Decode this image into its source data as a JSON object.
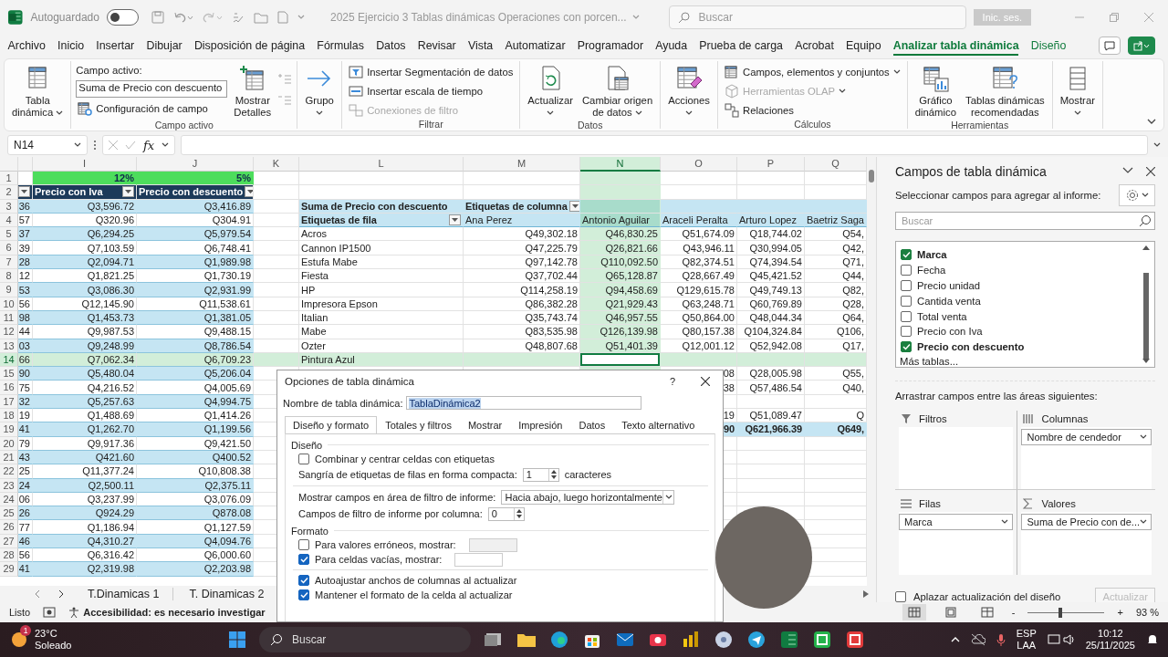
{
  "title_bar": {
    "autosave_label": "Autoguardado",
    "autosave_on": false,
    "document_title": "2025 Ejercicio 3 Tablas dinámicas Operaciones con porcen...",
    "search_placeholder": "Buscar",
    "sign_in_button": "Inic. ses."
  },
  "menu_tabs": [
    {
      "label": "Archivo",
      "selected": false,
      "contextual": false
    },
    {
      "label": "Inicio",
      "selected": false,
      "contextual": false
    },
    {
      "label": "Insertar",
      "selected": false,
      "contextual": false
    },
    {
      "label": "Dibujar",
      "selected": false,
      "contextual": false
    },
    {
      "label": "Disposición de página",
      "selected": false,
      "contextual": false
    },
    {
      "label": "Fórmulas",
      "selected": false,
      "contextual": false
    },
    {
      "label": "Datos",
      "selected": false,
      "contextual": false
    },
    {
      "label": "Revisar",
      "selected": false,
      "contextual": false
    },
    {
      "label": "Vista",
      "selected": false,
      "contextual": false
    },
    {
      "label": "Automatizar",
      "selected": false,
      "contextual": false
    },
    {
      "label": "Programador",
      "selected": false,
      "contextual": false
    },
    {
      "label": "Ayuda",
      "selected": false,
      "contextual": false
    },
    {
      "label": "Prueba de carga",
      "selected": false,
      "contextual": false
    },
    {
      "label": "Acrobat",
      "selected": false,
      "contextual": false
    },
    {
      "label": "Equipo",
      "selected": false,
      "contextual": false
    },
    {
      "label": "Analizar tabla dinámica",
      "selected": true,
      "contextual": true
    },
    {
      "label": "Diseño",
      "selected": false,
      "contextual": true
    }
  ],
  "ribbon_groups": [
    {
      "items": [
        {
          "kind": "large",
          "lines": [
            "Tabla",
            "dinámica"
          ],
          "caret": true,
          "disabled": false
        }
      ]
    },
    {
      "label": "Campo activo",
      "items": [
        {
          "kind": "stack",
          "items": [
            {
              "kind": "text",
              "label": "Campo activo:"
            },
            {
              "kind": "field",
              "value": "Suma de Precio con descuento"
            },
            {
              "kind": "small",
              "label": "Configuración de campo",
              "disabled": false
            }
          ]
        },
        {
          "kind": "large",
          "lines": [
            "Mostrar",
            "Detalles"
          ],
          "disabled": false
        },
        {
          "kind": "icons",
          "count_disabled": true
        }
      ]
    },
    {
      "items": [
        {
          "kind": "large",
          "lines": [
            "Grupo"
          ],
          "caret": true,
          "disabled": false
        }
      ]
    },
    {
      "label": "Filtrar",
      "items": [
        {
          "kind": "stack",
          "items": [
            {
              "kind": "small",
              "label": "Insertar Segmentación de datos",
              "disabled": false
            },
            {
              "kind": "small",
              "label": "Insertar escala de tiempo",
              "disabled": false
            },
            {
              "kind": "small",
              "label": "Conexiones de filtro",
              "disabled": true
            }
          ]
        }
      ]
    },
    {
      "label": "Datos",
      "items": [
        {
          "kind": "large",
          "lines": [
            "Actualizar"
          ],
          "caret": true,
          "disabled": false
        },
        {
          "kind": "large",
          "lines": [
            "Cambiar origen",
            "de datos"
          ],
          "caret": true,
          "disabled": false
        }
      ]
    },
    {
      "items": [
        {
          "kind": "large",
          "lines": [
            "Acciones"
          ],
          "caret": true,
          "disabled": false
        }
      ]
    },
    {
      "label": "Cálculos",
      "items": [
        {
          "kind": "stack",
          "items": [
            {
              "kind": "small",
              "label": "Campos, elementos y conjuntos",
              "caret": true,
              "disabled": false
            },
            {
              "kind": "small",
              "label": "Herramientas OLAP",
              "caret": true,
              "disabled": true
            },
            {
              "kind": "small",
              "label": "Relaciones",
              "disabled": false
            }
          ]
        }
      ]
    },
    {
      "label": "Herramientas",
      "items": [
        {
          "kind": "large",
          "lines": [
            "Gráfico",
            "dinámico"
          ],
          "disabled": false
        },
        {
          "kind": "large",
          "lines": [
            "Tablas dinámicas",
            "recomendadas"
          ],
          "disabled": false
        }
      ]
    },
    {
      "items": [
        {
          "kind": "large",
          "lines": [
            "Mostrar"
          ],
          "caret": true,
          "disabled": false
        }
      ]
    }
  ],
  "formula_bar": {
    "name_box": "N14",
    "function_label": "fx"
  },
  "sheet": {
    "column_headers": [
      {
        "label": "I",
        "selected": false
      },
      {
        "label": "J",
        "selected": false
      },
      {
        "label": "K",
        "selected": false
      },
      {
        "label": "L",
        "selected": false
      },
      {
        "label": "M",
        "selected": false
      },
      {
        "label": "N",
        "selected": true
      },
      {
        "label": "O",
        "selected": false
      },
      {
        "label": "P",
        "selected": false
      },
      {
        "label": "Q",
        "selected": false
      }
    ],
    "rows": [
      {
        "number": "1",
        "kind": "percent",
        "selected": false,
        "cells": [
          null,
          "12%",
          "5%",
          null,
          null,
          null,
          null,
          null,
          null,
          null
        ]
      },
      {
        "number": "2",
        "kind": "header",
        "selected": false,
        "cells": [
          {
            "filter": true
          },
          {
            "text": "Precio con Iva",
            "filter": true
          },
          {
            "text": "Precio con descuento",
            "filter": true
          },
          null,
          null,
          null,
          null,
          null,
          null,
          null
        ]
      },
      {
        "number": "3",
        "kind": "pivot-caption",
        "selected": false,
        "cells": [
          "36",
          "Q3,596.72",
          "Q3,416.89",
          null,
          "Suma de Precio con descuento",
          {
            "text": "Etiquetas de columna",
            "filter": true
          },
          null,
          null,
          null,
          null
        ]
      },
      {
        "number": "4",
        "kind": "pivot-header",
        "selected": false,
        "cells": [
          "57",
          "Q320.96",
          "Q304.91",
          null,
          {
            "text": "Etiquetas de fila",
            "filter": true
          },
          "Ana Perez",
          "Antonio Aguilar",
          "Araceli Peralta",
          "Arturo Lopez",
          "Baetriz Saga"
        ]
      },
      {
        "number": "5",
        "kind": "data",
        "selected": false,
        "cells": [
          "37",
          "Q6,294.25",
          "Q5,979.54",
          null,
          "Acros",
          "Q49,302.18",
          "Q46,830.25",
          "Q51,674.09",
          "Q18,744.02",
          "Q54,"
        ]
      },
      {
        "number": "6",
        "kind": "data",
        "selected": false,
        "cells": [
          "39",
          "Q7,103.59",
          "Q6,748.41",
          null,
          "Cannon IP1500",
          "Q47,225.79",
          "Q26,821.66",
          "Q43,946.11",
          "Q30,994.05",
          "Q42,"
        ]
      },
      {
        "number": "7",
        "kind": "data",
        "selected": false,
        "cells": [
          "28",
          "Q2,094.71",
          "Q1,989.98",
          null,
          "Estufa Mabe",
          "Q97,142.78",
          "Q110,092.50",
          "Q82,374.51",
          "Q74,394.54",
          "Q71,"
        ]
      },
      {
        "number": "8",
        "kind": "data",
        "selected": false,
        "cells": [
          "12",
          "Q1,821.25",
          "Q1,730.19",
          null,
          "Fiesta",
          "Q37,702.44",
          "Q65,128.87",
          "Q28,667.49",
          "Q45,421.52",
          "Q44,"
        ]
      },
      {
        "number": "9",
        "kind": "data",
        "selected": false,
        "cells": [
          "53",
          "Q3,086.30",
          "Q2,931.99",
          null,
          "HP",
          "Q114,258.19",
          "Q94,458.69",
          "Q129,615.78",
          "Q49,749.13",
          "Q82,"
        ]
      },
      {
        "number": "10",
        "kind": "data",
        "selected": false,
        "cells": [
          "56",
          "Q12,145.90",
          "Q11,538.61",
          null,
          "Impresora Epson",
          "Q86,382.28",
          "Q21,929.43",
          "Q63,248.71",
          "Q60,769.89",
          "Q28,"
        ]
      },
      {
        "number": "11",
        "kind": "data",
        "selected": false,
        "cells": [
          "98",
          "Q1,453.73",
          "Q1,381.05",
          null,
          "Italian",
          "Q35,743.74",
          "Q46,957.55",
          "Q50,864.00",
          "Q48,044.34",
          "Q64,"
        ]
      },
      {
        "number": "12",
        "kind": "data",
        "selected": false,
        "cells": [
          "44",
          "Q9,987.53",
          "Q9,488.15",
          null,
          "Mabe",
          "Q83,535.98",
          "Q126,139.98",
          "Q80,157.38",
          "Q104,324.84",
          "Q106,"
        ]
      },
      {
        "number": "13",
        "kind": "data",
        "selected": false,
        "cells": [
          "03",
          "Q9,248.99",
          "Q8,786.54",
          null,
          "Ozter",
          "Q48,807.68",
          "Q51,401.39",
          "Q12,001.12",
          "Q52,942.08",
          "Q17,"
        ]
      },
      {
        "number": "14",
        "kind": "data",
        "selected": true,
        "cells": [
          "66",
          "Q7,062.34",
          "Q6,709.23",
          null,
          "Pintura Azul",
          null,
          null,
          null,
          null,
          null
        ]
      },
      {
        "number": "15",
        "kind": "data",
        "selected": false,
        "cells": [
          "90",
          "Q5,480.04",
          "Q5,206.04",
          null,
          null,
          null,
          null,
          "08",
          "Q28,005.98",
          "Q55,"
        ]
      },
      {
        "number": "16",
        "kind": "data",
        "selected": false,
        "cells": [
          "75",
          "Q4,216.52",
          "Q4,005.69",
          null,
          null,
          null,
          null,
          "38",
          "Q57,486.54",
          "Q40,"
        ]
      },
      {
        "number": "17",
        "kind": "data",
        "selected": false,
        "cells": [
          "32",
          "Q5,257.63",
          "Q4,994.75",
          null,
          null,
          null,
          null,
          null,
          null,
          null
        ]
      },
      {
        "number": "18",
        "kind": "data",
        "selected": false,
        "cells": [
          "19",
          "Q1,488.69",
          "Q1,414.26",
          null,
          null,
          null,
          null,
          "19",
          "Q51,089.47",
          "Q"
        ]
      },
      {
        "number": "19",
        "kind": "pivot-total",
        "selected": false,
        "cells": [
          "41",
          "Q1,262.70",
          "Q1,199.56",
          null,
          null,
          null,
          null,
          "90",
          "Q621,966.39",
          "Q649,"
        ]
      },
      {
        "number": "20",
        "kind": "data",
        "selected": false,
        "cells": [
          "79",
          "Q9,917.36",
          "Q9,421.50",
          null,
          null,
          null,
          null,
          null,
          null,
          null
        ]
      },
      {
        "number": "21",
        "kind": "data",
        "selected": false,
        "cells": [
          "43",
          "Q421.60",
          "Q400.52",
          null,
          null,
          null,
          null,
          null,
          null,
          null
        ]
      },
      {
        "number": "22",
        "kind": "data",
        "selected": false,
        "cells": [
          "25",
          "Q11,377.24",
          "Q10,808.38",
          null,
          null,
          null,
          null,
          null,
          null,
          null
        ]
      },
      {
        "number": "23",
        "kind": "data",
        "selected": false,
        "cells": [
          "24",
          "Q2,500.11",
          "Q2,375.11",
          null,
          null,
          null,
          null,
          null,
          null,
          null
        ]
      },
      {
        "number": "24",
        "kind": "data",
        "selected": false,
        "cells": [
          "06",
          "Q3,237.99",
          "Q3,076.09",
          null,
          null,
          null,
          null,
          null,
          null,
          null
        ]
      },
      {
        "number": "25",
        "kind": "data",
        "selected": false,
        "cells": [
          "26",
          "Q924.29",
          "Q878.08",
          null,
          null,
          null,
          null,
          null,
          null,
          null
        ]
      },
      {
        "number": "26",
        "kind": "data",
        "selected": false,
        "cells": [
          "77",
          "Q1,186.94",
          "Q1,127.59",
          null,
          null,
          null,
          null,
          null,
          null,
          null
        ]
      },
      {
        "number": "27",
        "kind": "data",
        "selected": false,
        "cells": [
          "46",
          "Q4,310.27",
          "Q4,094.76",
          null,
          null,
          null,
          null,
          null,
          null,
          null
        ]
      },
      {
        "number": "28",
        "kind": "data",
        "selected": false,
        "cells": [
          "56",
          "Q6,316.42",
          "Q6,000.60",
          null,
          null,
          null,
          null,
          null,
          null,
          null
        ]
      },
      {
        "number": "29",
        "kind": "data",
        "selected": false,
        "cells": [
          "41",
          "Q2,319.98",
          "Q2,203.98",
          null,
          null,
          null,
          null,
          null,
          null,
          null
        ]
      }
    ]
  },
  "sheet_tabs": [
    {
      "label": "T.Dinamicas 1"
    },
    {
      "label": "T. Dinamicas 2"
    }
  ],
  "dialog": {
    "title": "Opciones de tabla dinámica",
    "help": "?",
    "name_label": "Nombre de tabla dinámica:",
    "name_value": "TablaDinámica2",
    "tabs": [
      {
        "label": "Diseño y formato",
        "selected": true
      },
      {
        "label": "Totales y filtros",
        "selected": false
      },
      {
        "label": "Mostrar",
        "selected": false
      },
      {
        "label": "Impresión",
        "selected": false
      },
      {
        "label": "Datos",
        "selected": false
      },
      {
        "label": "Texto alternativo",
        "selected": false
      }
    ],
    "sections": [
      {
        "heading": "Diseño",
        "rows": [
          {
            "kind": "checkbox",
            "label": "Combinar y centrar celdas con etiquetas",
            "checked": false
          },
          {
            "kind": "spinner",
            "label": "Sangría de etiquetas de filas en forma compacta:",
            "value": "1",
            "suffix": "caracteres"
          },
          {
            "kind": "separator"
          },
          {
            "kind": "dropdown",
            "label": "Mostrar campos en área de filtro de informe:",
            "value": "Hacia abajo, luego horizontalmente"
          },
          {
            "kind": "spinner",
            "label": "Campos de filtro de informe por columna:",
            "value": "0"
          }
        ]
      },
      {
        "heading": "Formato",
        "rows": [
          {
            "kind": "checkbox-field",
            "label": "Para valores erróneos, mostrar:",
            "checked": false,
            "field_disabled": true
          },
          {
            "kind": "checkbox-field",
            "label": "Para celdas vacías, mostrar:",
            "checked": true,
            "field_disabled": false
          },
          {
            "kind": "separator"
          },
          {
            "kind": "checkbox",
            "label": "Autoajustar anchos de columnas al actualizar",
            "checked": true
          },
          {
            "kind": "checkbox",
            "label": "Mantener el formato de la celda al actualizar",
            "checked": true
          }
        ]
      }
    ]
  },
  "field_pane": {
    "title": "Campos de tabla dinámica",
    "subtitle": "Seleccionar campos para agregar al informe:",
    "search_placeholder": "Buscar",
    "fields": [
      {
        "label": "Marca",
        "checked": true
      },
      {
        "label": "Fecha",
        "checked": false
      },
      {
        "label": "Precio unidad",
        "checked": false
      },
      {
        "label": "Cantida venta",
        "checked": false
      },
      {
        "label": "Total venta",
        "checked": false
      },
      {
        "label": "Precio con Iva",
        "checked": false
      },
      {
        "label": "Precio con descuento",
        "checked": true
      }
    ],
    "more_tables_link": "Más tablas...",
    "drag_hint": "Arrastrar campos entre las áreas siguientes:",
    "areas": [
      {
        "kind": "filters",
        "label": "Filtros"
      },
      {
        "kind": "columns",
        "label": "Columnas",
        "items": [
          "Nombre de cendedor"
        ]
      },
      {
        "kind": "rows",
        "label": "Filas",
        "items": [
          "Marca"
        ]
      },
      {
        "kind": "values",
        "label": "Valores",
        "items": [
          "Suma de Precio con de..."
        ]
      }
    ],
    "defer": {
      "label": "Aplazar actualización del diseño",
      "checked": false
    },
    "update_button": {
      "label": "Actualizar",
      "disabled": true
    }
  },
  "status_bar": {
    "ready": "Listo",
    "accessibility": "Accesibilidad: es necesario investigar",
    "views": [
      {
        "selected": true
      },
      {
        "selected": false
      },
      {
        "selected": false
      }
    ],
    "zoom": {
      "minus": "-",
      "plus": "+",
      "level": 0.42,
      "reading": "93 %"
    }
  },
  "taskbar": {
    "weather": {
      "badge": "1",
      "temperature": "23°C",
      "condition": "Soleado"
    },
    "search_label": "Buscar",
    "tray": {
      "language": "ESP",
      "layout": "LAA",
      "time": "10:12",
      "date": "25/11/2025"
    }
  }
}
